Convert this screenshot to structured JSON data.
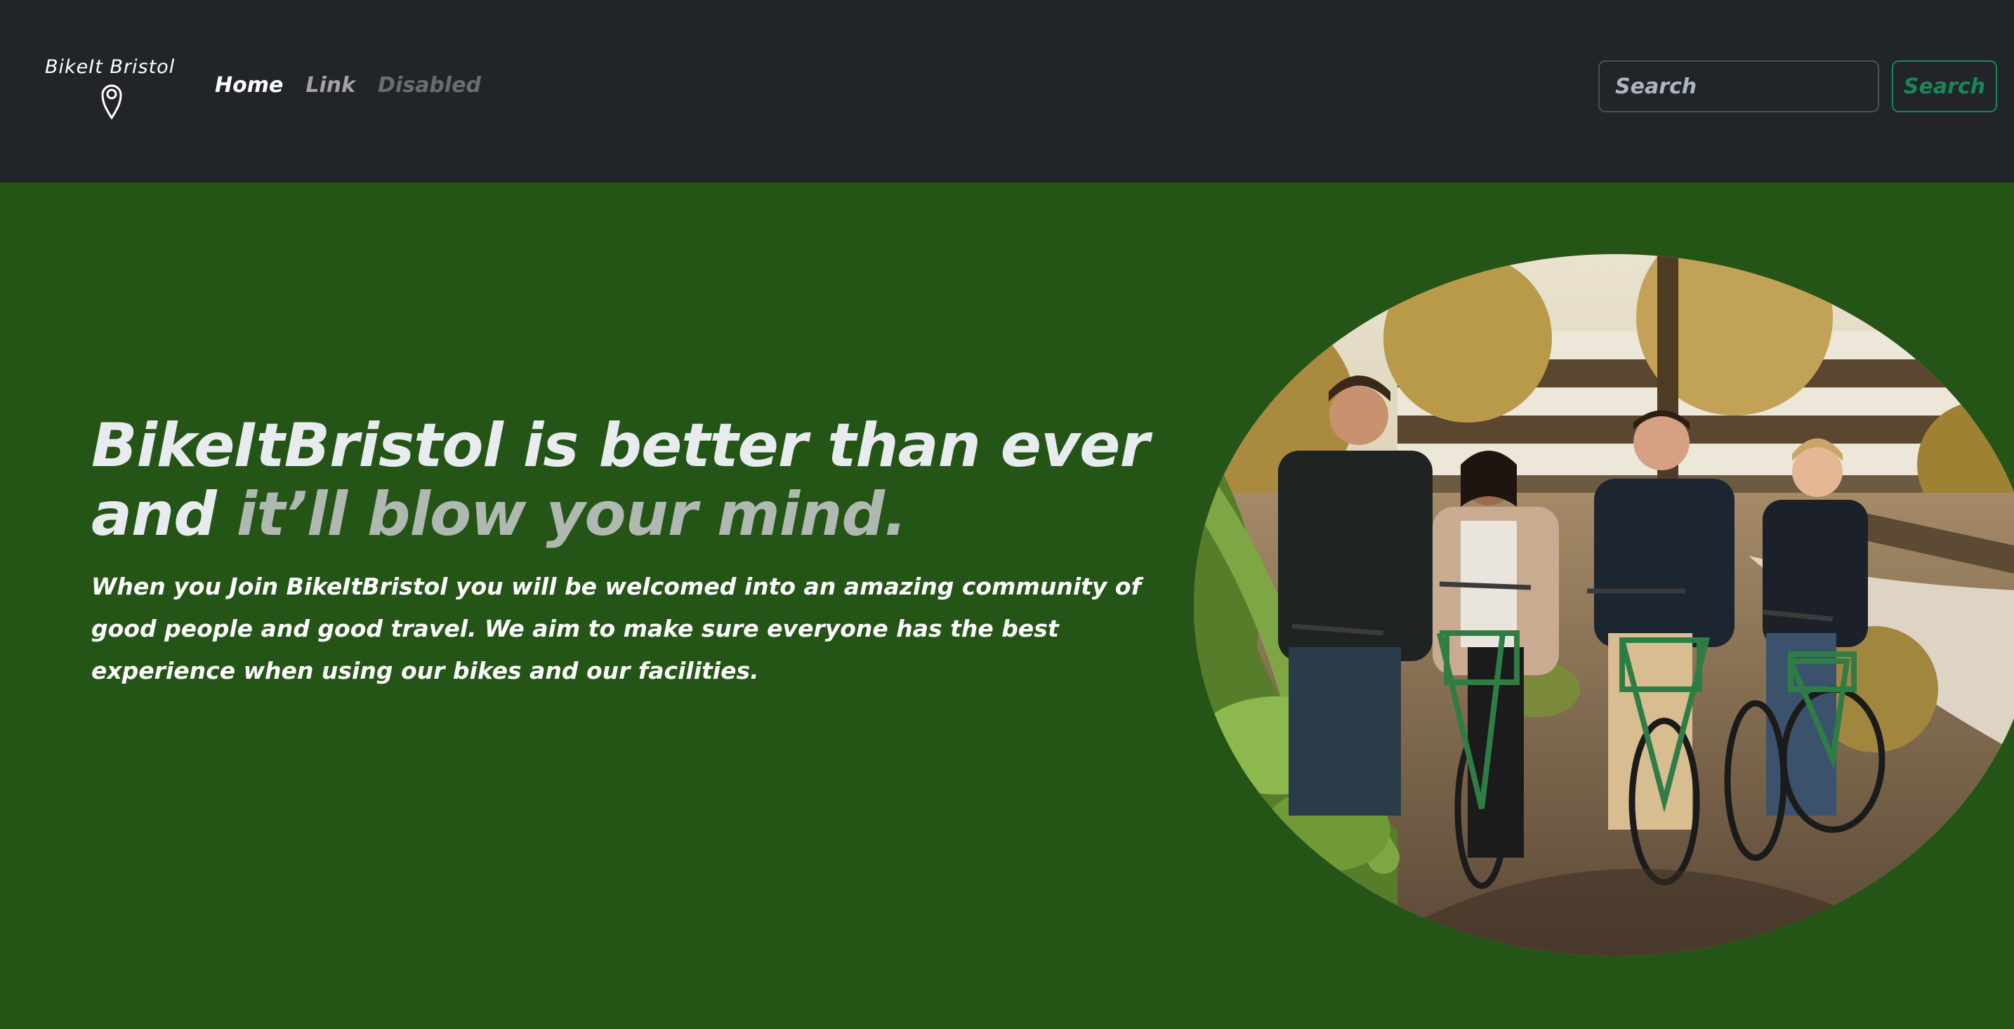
{
  "navbar": {
    "logo_text": "BikeIt Bristol",
    "links": [
      {
        "label": "Home",
        "state": "active"
      },
      {
        "label": "Link",
        "state": "normal"
      },
      {
        "label": "Disabled",
        "state": "disabled"
      }
    ],
    "search_placeholder": "Search",
    "search_button_label": "Search"
  },
  "hero": {
    "headline_main": "BikeItBristol is better than ever",
    "headline_lead": "and",
    "headline_accent": "it’ll blow your mind.",
    "body": "When you Join BikeItBristol you will be welcomed into an amazing community of good people and good travel. We aim to make sure everyone has the best experience when using our bikes and our facilities."
  },
  "colors": {
    "navbar_bg": "#212529",
    "hero_bg": "#245517",
    "search_button": "#198754",
    "headline": "#e9ecef",
    "headline_accent": "#b0b8b2"
  }
}
